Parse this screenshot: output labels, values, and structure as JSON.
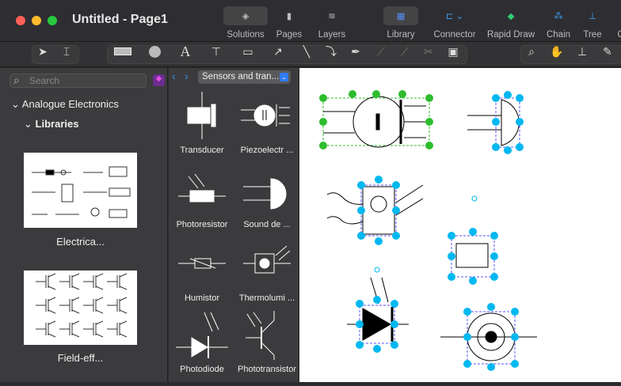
{
  "window": {
    "title": "Untitled - Page1"
  },
  "top_toolbar": [
    {
      "label": "Solutions",
      "icon": "solutions-icon"
    },
    {
      "label": "Pages",
      "icon": "pages-icon"
    },
    {
      "label": "Layers",
      "icon": "layers-icon"
    },
    {
      "label": "Library",
      "icon": "library-icon"
    },
    {
      "label": "Connector",
      "icon": "connector-icon"
    },
    {
      "label": "Rapid Draw",
      "icon": "rapid-draw-icon"
    },
    {
      "label": "Chain",
      "icon": "chain-icon"
    },
    {
      "label": "Tree",
      "icon": "tree-icon"
    },
    {
      "label": "O",
      "icon": "more-icon"
    }
  ],
  "left_panel": {
    "search_placeholder": "Search",
    "tree_root": "Analogue Electronics",
    "tree_child": "Libraries",
    "libraries": [
      {
        "label": "Electrica..."
      },
      {
        "label": "Field-eff..."
      }
    ]
  },
  "library_panel": {
    "selected": "Sensors and tran...",
    "items": [
      {
        "label": "Transducer"
      },
      {
        "label": "Piezoelectr ..."
      },
      {
        "label": "Photoresistor"
      },
      {
        "label": "Sound de ..."
      },
      {
        "label": "Humistor"
      },
      {
        "label": "Thermolumi ..."
      },
      {
        "label": "Photodiode"
      },
      {
        "label": "Phototransistor"
      }
    ]
  },
  "colors": {
    "handle": "#00b8f0",
    "selected_handle": "#2ebd2e",
    "accent": "#2f7cf6"
  }
}
